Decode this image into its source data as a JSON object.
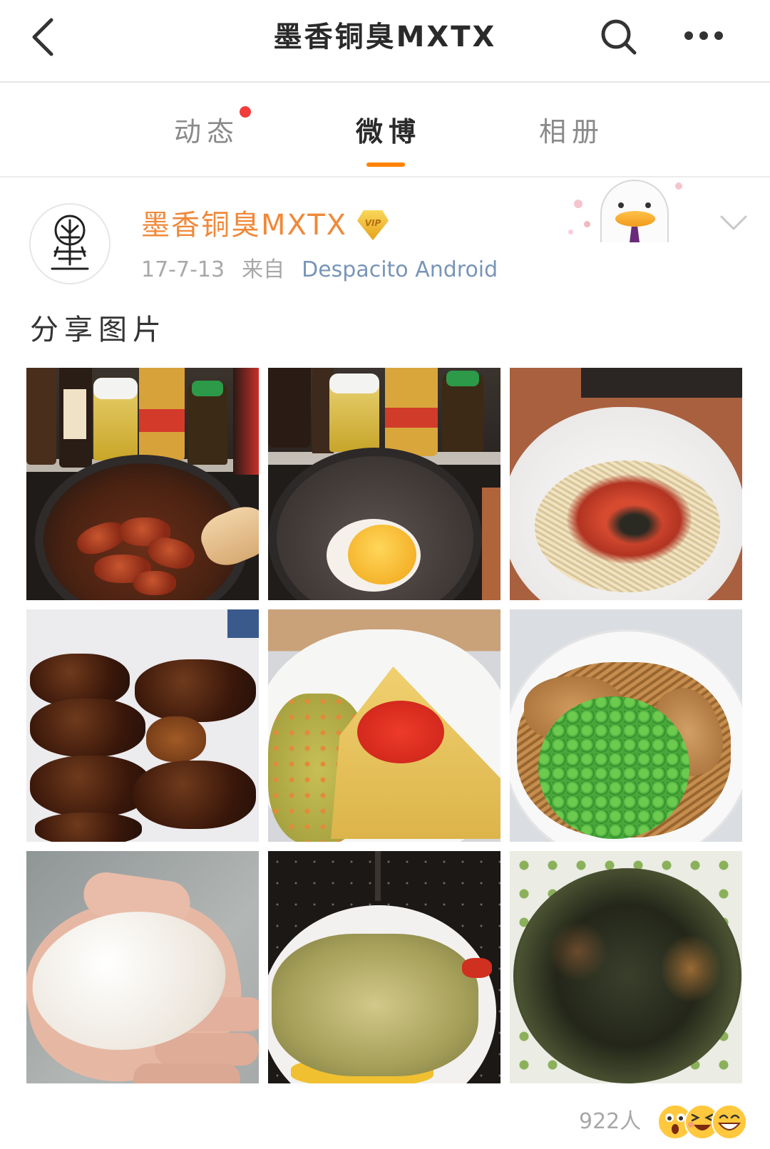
{
  "header": {
    "title": "墨香铜臭MXTX",
    "back_icon": "chevron-left-icon",
    "search_icon": "search-icon",
    "more_icon": "more-dots-icon"
  },
  "tabs": [
    {
      "label": "动态",
      "active": false,
      "has_notification": true
    },
    {
      "label": "微博",
      "active": true,
      "has_notification": false
    },
    {
      "label": "相册",
      "active": false,
      "has_notification": false
    }
  ],
  "post": {
    "author": "墨香铜臭MXTX",
    "author_badge": "VIP",
    "date": "17-7-13",
    "source_prefix": "来自",
    "source": "Despacito Android",
    "text": "分享图片",
    "menu_icon": "chevron-down-icon",
    "reactions": {
      "count": "922人",
      "emoji_icons": [
        "surprised-face-icon",
        "laughing-face-icon",
        "grinning-face-icon"
      ]
    }
  },
  "colors": {
    "accent": "#ff8200",
    "username": "#f0893a",
    "notify": "#f23b3b",
    "source": "#7895b8",
    "muted": "#a8a8a8"
  }
}
